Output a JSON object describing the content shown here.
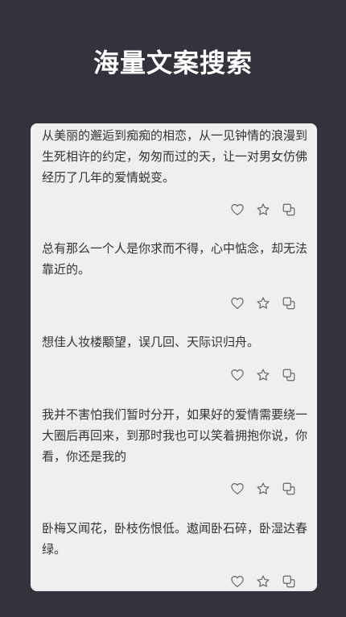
{
  "header": {
    "title": "海量文案搜索"
  },
  "quotes": [
    {
      "text": "从美丽的邂逅到痴痴的相恋，从一见钟情的浪漫到生死相许的约定，匆匆而过的天，让一对男女仿佛经历了几年的爱情蜕变。"
    },
    {
      "text": "总有那么一个人是你求而不得，心中惦念，却无法靠近的。"
    },
    {
      "text": "想佳人妆楼颙望，误几回、天际识归舟。"
    },
    {
      "text": "我并不害怕我们暂时分开，如果好的爱情需要绕一大圈后再回来，到那时我也可以笑着拥抱你说，你看，你还是我的"
    },
    {
      "text": "卧梅又闻花，卧枝伤恨低。遨闻卧石碎，卧湿达春绿。"
    }
  ],
  "icons": {
    "like": "heart-icon",
    "favorite": "star-icon",
    "copy": "copy-icon"
  },
  "colors": {
    "background": "#33323d",
    "card": "#efefef",
    "text": "#333333",
    "icon": "#666666"
  }
}
